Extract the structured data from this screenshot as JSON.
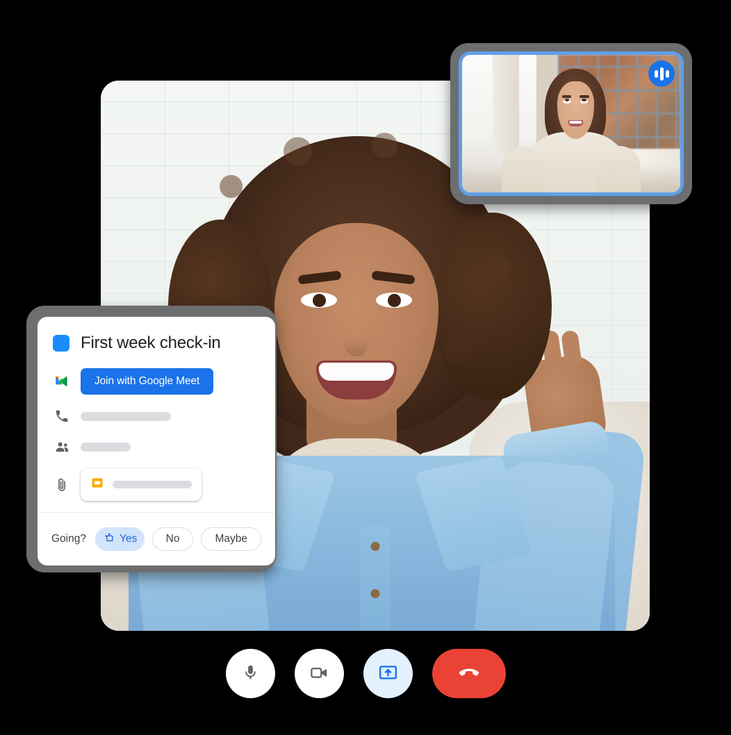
{
  "app": {
    "name": "Google Meet video call",
    "background_color": "#000000"
  },
  "main_video": {
    "name": "main-participant-video",
    "description": "Smiling woman with curly hair waving, in a denim jacket"
  },
  "pip_window": {
    "name": "self-view-pip",
    "description": "Second participant seated in front of a bookshelf",
    "border_color": "#5f9fe8",
    "audio_indicator": {
      "icon": "audio-waveform-icon",
      "color": "#1a73e8"
    }
  },
  "calendar_card": {
    "color_chip": "#1a8cff",
    "title": "First week check-in",
    "join_button": {
      "label": "Join with Google Meet",
      "icon": "google-meet-icon",
      "color": "#1a73e8"
    },
    "rows": [
      {
        "icon": "phone-icon",
        "value": ""
      },
      {
        "icon": "people-icon",
        "value": ""
      },
      {
        "icon": "attachment-icon",
        "value": "",
        "chip_icon": "google-slides-icon"
      }
    ],
    "rsvp": {
      "label": "Going?",
      "options": [
        {
          "label": "Yes",
          "selected": true,
          "icon": "rsvp-yes-icon",
          "caret": "chevron-down-icon"
        },
        {
          "label": "No",
          "selected": false
        },
        {
          "label": "Maybe",
          "selected": false
        }
      ]
    }
  },
  "controls": [
    {
      "name": "microphone-button",
      "icon": "microphone-icon",
      "state": "on",
      "style": "light"
    },
    {
      "name": "camera-button",
      "icon": "video-camera-icon",
      "state": "on",
      "style": "light"
    },
    {
      "name": "present-button",
      "icon": "present-screen-icon",
      "state": "active",
      "style": "blue"
    },
    {
      "name": "leave-call-button",
      "icon": "hangup-phone-icon",
      "state": "default",
      "style": "red"
    }
  ]
}
